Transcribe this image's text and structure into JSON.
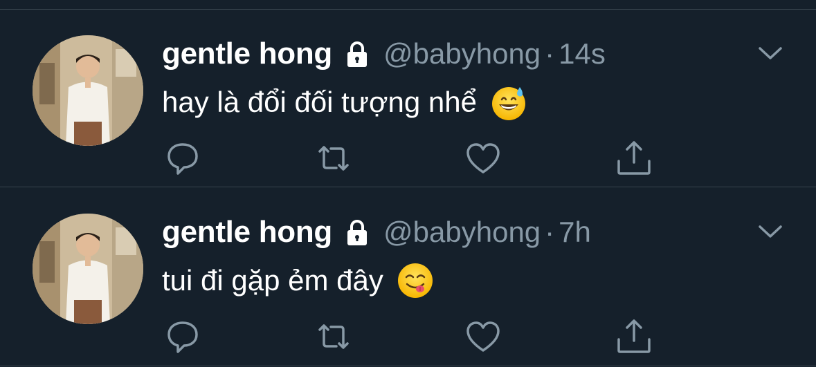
{
  "tweets": [
    {
      "author_name": "gentle hong",
      "handle": "@babyhong",
      "separator": "·",
      "time": "14s",
      "text": "hay là đổi đối tượng nhể",
      "emoji": "grinning-face-with-sweat"
    },
    {
      "author_name": "gentle hong",
      "handle": "@babyhong",
      "separator": "·",
      "time": "7h",
      "text": "tui đi gặp ẻm đây",
      "emoji": "face-savoring-food"
    }
  ],
  "icons": {
    "lock": "lock-icon",
    "caret": "chevron-down-icon",
    "reply": "reply-icon",
    "retweet": "retweet-icon",
    "like": "like-heart-icon",
    "share": "share-icon"
  },
  "colors": {
    "background": "#15202b",
    "primary_text": "#ffffff",
    "secondary_text": "#8899a6",
    "divider": "#38444d"
  }
}
